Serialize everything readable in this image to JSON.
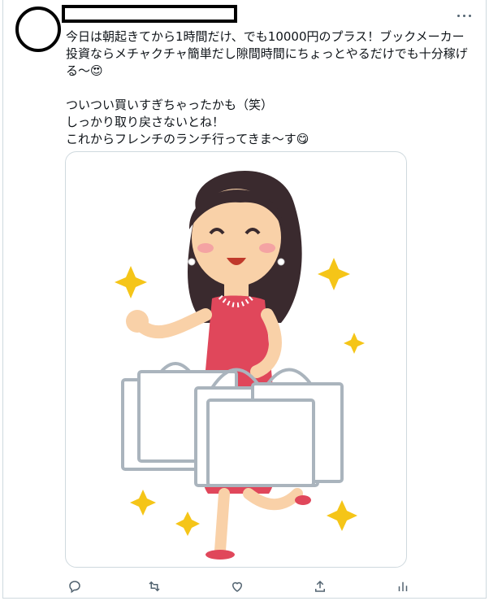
{
  "tweet": {
    "body": "今日は朝起きてから1時間だけ、でも10000円のプラス！ブックメーカー投資ならメチャクチャ簡単だし隙間時間にちょっとやるだけでも十分稼げる～😍\n\nついつい買いすぎちゃったかも（笑）\nしっかり取り戻さないとね！\nこれからフレンチのランチ行ってきま～す😋"
  },
  "icons": {
    "more": "more-horizontal-icon",
    "reply": "reply-icon",
    "retweet": "retweet-icon",
    "like": "heart-icon",
    "share": "share-icon",
    "analytics": "analytics-icon"
  },
  "colors": {
    "icon": "#536471",
    "border": "#cfd9de",
    "dress": "#e0475b",
    "skin": "#f9d1a8",
    "hair": "#3a2a2e",
    "sparkle": "#f5c518"
  }
}
